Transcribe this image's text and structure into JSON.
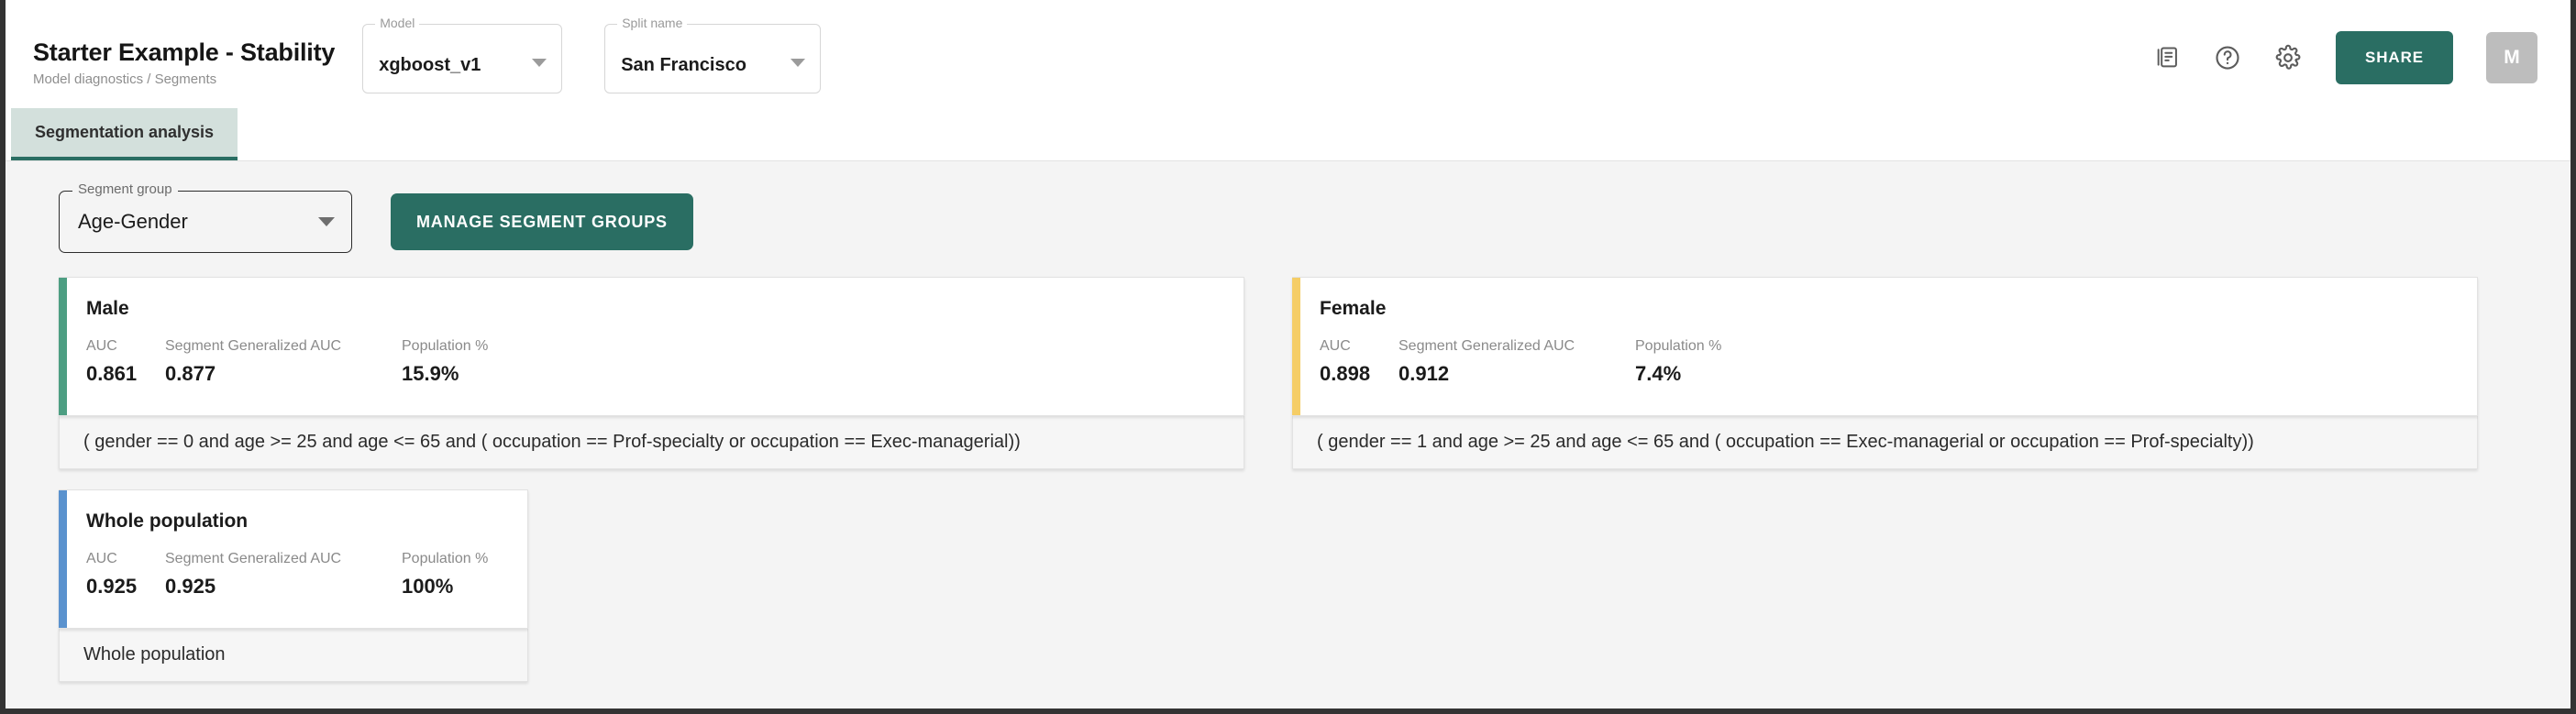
{
  "header": {
    "title": "Starter Example - Stability",
    "breadcrumb": "Model diagnostics / Segments",
    "model_select": {
      "label": "Model",
      "value": "xgboost_v1"
    },
    "split_select": {
      "label": "Split name",
      "value": "San Francisco"
    },
    "actions": {
      "report_icon": "report-icon",
      "help_icon": "help-circle-icon",
      "settings_icon": "gear-icon",
      "share_label": "SHARE",
      "avatar_initial": "M"
    }
  },
  "tabs": [
    {
      "label": "Segmentation analysis",
      "active": true
    }
  ],
  "controls": {
    "segment_group": {
      "label": "Segment group",
      "value": "Age-Gender"
    },
    "manage_button": "MANAGE SEGMENT GROUPS"
  },
  "metric_labels": {
    "auc": "AUC",
    "generalized_auc": "Segment Generalized AUC",
    "population": "Population %"
  },
  "colors": {
    "accent_green": "#4d9e82",
    "accent_yellow": "#f5cd66",
    "accent_blue": "#5a92ce",
    "brand_teal": "#2a6e63",
    "tab_active_bg": "#d3e0dc",
    "page_bg": "#f4f4f4"
  },
  "segments": [
    {
      "name": "Male",
      "auc": "0.861",
      "generalized_auc": "0.877",
      "population": "15.9%",
      "expression": "( gender == 0 and age >= 25 and age <= 65 and ( occupation == Prof-specialty or occupation == Exec-managerial))",
      "accent": "#4d9e82"
    },
    {
      "name": "Female",
      "auc": "0.898",
      "generalized_auc": "0.912",
      "population": "7.4%",
      "expression": "( gender == 1 and age >= 25 and age <= 65 and ( occupation == Exec-managerial or occupation == Prof-specialty))",
      "accent": "#f5cd66"
    },
    {
      "name": "Whole population",
      "auc": "0.925",
      "generalized_auc": "0.925",
      "population": "100%",
      "expression": "Whole population",
      "accent": "#5a92ce"
    }
  ]
}
